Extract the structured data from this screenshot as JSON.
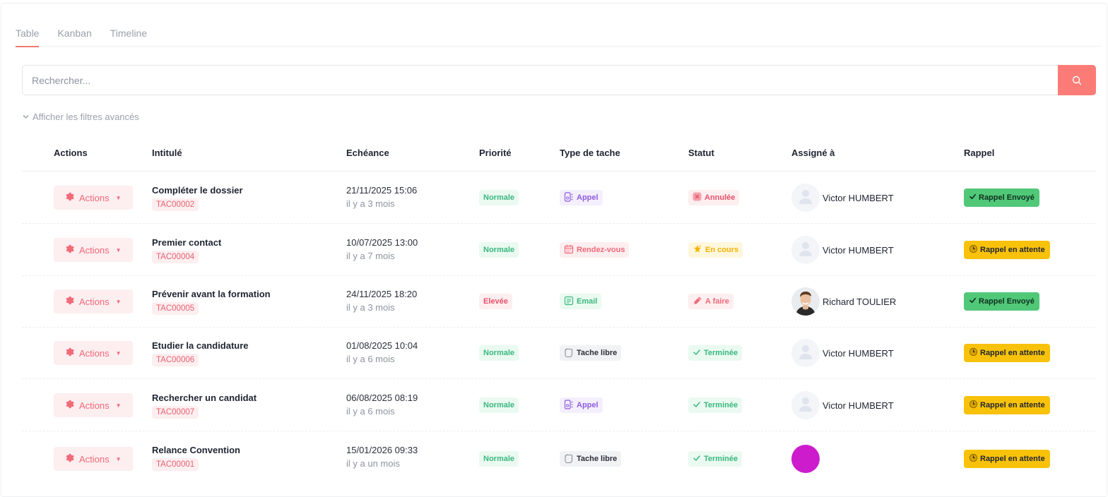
{
  "tabs": [
    {
      "label": "Table",
      "active": true
    },
    {
      "label": "Kanban",
      "active": false
    },
    {
      "label": "Timeline",
      "active": false
    }
  ],
  "search": {
    "placeholder": "Rechercher..."
  },
  "filters": {
    "toggle_label": "Afficher les filtres avancés"
  },
  "columns": {
    "actions": "Actions",
    "intitule": "Intitulé",
    "echeance": "Echéance",
    "priorite": "Priorité",
    "type": "Type de tache",
    "statut": "Statut",
    "assigne": "Assigné à",
    "rappel": "Rappel"
  },
  "rows": [
    {
      "action_label": "Actions",
      "title": "Compléter le dossier",
      "ref": "TAC00002",
      "date": "21/11/2025 15:06",
      "relative": "il y a 3 mois",
      "priority": "Normale",
      "type": "Appel",
      "status": "Annulée",
      "assignee": "Victor HUMBERT",
      "rappel": "Rappel Envoyé"
    },
    {
      "action_label": "Actions",
      "title": "Premier contact",
      "ref": "TAC00004",
      "date": "10/07/2025 13:00",
      "relative": "il y a 7 mois",
      "priority": "Normale",
      "type": "Rendez-vous",
      "status": "En cours",
      "assignee": "Victor HUMBERT",
      "rappel": "Rappel en attente"
    },
    {
      "action_label": "Actions",
      "title": "Prévenir avant la formation",
      "ref": "TAC00005",
      "date": "24/11/2025 18:20",
      "relative": "il y a 3 mois",
      "priority": "Elevée",
      "type": "Email",
      "status": "A faire",
      "assignee": "Richard TOULIER",
      "rappel": "Rappel Envoyé"
    },
    {
      "action_label": "Actions",
      "title": "Etudier la candidature",
      "ref": "TAC00006",
      "date": "01/08/2025 10:04",
      "relative": "il y a 6 mois",
      "priority": "Normale",
      "type": "Tache libre",
      "status": "Terminée",
      "assignee": "Victor HUMBERT",
      "rappel": "Rappel en attente"
    },
    {
      "action_label": "Actions",
      "title": "Rechercher un candidat",
      "ref": "TAC00007",
      "date": "06/08/2025 08:19",
      "relative": "il y a 6 mois",
      "priority": "Normale",
      "type": "Appel",
      "status": "Terminée",
      "assignee": "Victor HUMBERT",
      "rappel": "Rappel en attente"
    },
    {
      "action_label": "Actions",
      "title": "Relance Convention",
      "ref": "TAC00001",
      "date": "15/01/2026 09:33",
      "relative": "il y a un mois",
      "priority": "Normale",
      "type": "Tache libre",
      "status": "Terminée",
      "assignee": "",
      "rappel": "Rappel en attente"
    }
  ],
  "colors": {
    "accent": "#fb7c76",
    "sent": "#50c878",
    "waiting": "#f8c20a"
  }
}
